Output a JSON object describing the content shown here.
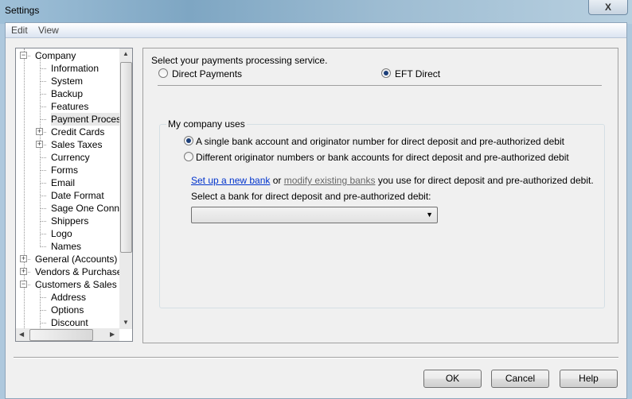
{
  "window": {
    "title": "Settings",
    "close": "X"
  },
  "menu": [
    {
      "label": "Edit"
    },
    {
      "label": "View"
    }
  ],
  "tree": [
    {
      "label": "Company",
      "level": 0,
      "expander": "minus"
    },
    {
      "label": "Information",
      "level": 1
    },
    {
      "label": "System",
      "level": 1
    },
    {
      "label": "Backup",
      "level": 1
    },
    {
      "label": "Features",
      "level": 1
    },
    {
      "label": "Payment Processing",
      "level": 1,
      "selected": true
    },
    {
      "label": "Credit Cards",
      "level": 1,
      "expander": "plus"
    },
    {
      "label": "Sales Taxes",
      "level": 1,
      "expander": "plus"
    },
    {
      "label": "Currency",
      "level": 1
    },
    {
      "label": "Forms",
      "level": 1
    },
    {
      "label": "Email",
      "level": 1
    },
    {
      "label": "Date Format",
      "level": 1
    },
    {
      "label": "Sage One Connect",
      "level": 1
    },
    {
      "label": "Shippers",
      "level": 1
    },
    {
      "label": "Logo",
      "level": 1
    },
    {
      "label": "Names",
      "level": 1
    },
    {
      "label": "General (Accounts)",
      "level": 0,
      "expander": "plus"
    },
    {
      "label": "Vendors & Purchases",
      "level": 0,
      "expander": "plus"
    },
    {
      "label": "Customers & Sales",
      "level": 0,
      "expander": "minus"
    },
    {
      "label": "Address",
      "level": 1
    },
    {
      "label": "Options",
      "level": 1
    },
    {
      "label": "Discount",
      "level": 1
    }
  ],
  "panel": {
    "prompt": "Select your payments processing service.",
    "service_options": [
      {
        "label": "Direct Payments",
        "selected": false
      },
      {
        "label": "EFT Direct",
        "selected": true
      }
    ],
    "group_title": "My company uses",
    "bank_options": [
      {
        "label": "A single bank account and originator number for direct deposit and pre-authorized debit",
        "selected": true
      },
      {
        "label": "Different originator numbers or bank accounts for direct deposit and pre-authorized debit",
        "selected": false
      }
    ],
    "link_setup": "Set up a new bank",
    "link_or": " or ",
    "link_modify": "modify existing banks",
    "link_suffix": " you use for direct deposit and pre-authorized debit.",
    "select_label": "Select a bank for direct deposit and pre-authorized debit:",
    "select_value": ""
  },
  "buttons": {
    "ok": "OK",
    "cancel": "Cancel",
    "help": "Help"
  }
}
